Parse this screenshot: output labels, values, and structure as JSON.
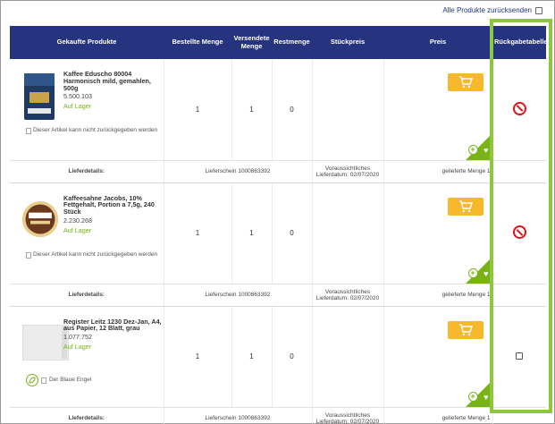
{
  "header": {
    "return_all_label": "Alle Produkte zurücksenden"
  },
  "columns": [
    "Gekaufte Produkte",
    "Bestellte Menge",
    "Versendete Menge",
    "Restmenge",
    "Stückpreis",
    "Preis",
    "Rückgabetabelle"
  ],
  "products": [
    {
      "name": "Kaffee Eduscho 80004 Harmonisch mild, gemahlen, 500g",
      "number": "5.500.103",
      "stock": "Auf Lager",
      "ordered": "1",
      "shipped": "1",
      "remaining": "0",
      "note_alt": "Dieser Artikel kann nicht zurückgegeben werden",
      "returnable": false,
      "delivery": {
        "label": "Lieferdetails:",
        "note": "Lieferschein 1000863392",
        "date": "Voraussichtliches Lieferdatum: 02/07/2020",
        "qty": "gelieferte Menge 1"
      }
    },
    {
      "name": "Kaffeesahne Jacobs, 10% Fettgehalt, Portion a 7,5g, 240 Stück",
      "number": "2.230.268",
      "stock": "Auf Lager",
      "ordered": "1",
      "shipped": "1",
      "remaining": "0",
      "note_alt": "Dieser Artikel kann nicht zurückgegeben werden",
      "returnable": false,
      "delivery": {
        "label": "Lieferdetails:",
        "note": "Lieferschein 1000863392",
        "date": "Voraussichtliches Lieferdatum: 02/07/2020",
        "qty": "gelieferte Menge 1"
      }
    },
    {
      "name": "Register Leitz 1230 Dez-Jan, A4, aus Papier, 12 Blatt, grau",
      "number": "1.077.752",
      "stock": "Auf Lager",
      "ordered": "1",
      "shipped": "1",
      "remaining": "0",
      "note_alt": "Der Blaue Engel",
      "returnable": true,
      "delivery": {
        "label": "Lieferdetails:",
        "note": "Lieferschein 1000863392",
        "date": "Voraussichtliches Lieferdatum: 02/07/2020",
        "qty": "gelieferte Menge 1"
      }
    }
  ],
  "colors": {
    "header_bg": "#26337e",
    "accent_green": "#7ab317",
    "cart_orange": "#f7b82b",
    "highlight_green": "#8dc63f",
    "no_return_red": "#d9141a"
  }
}
